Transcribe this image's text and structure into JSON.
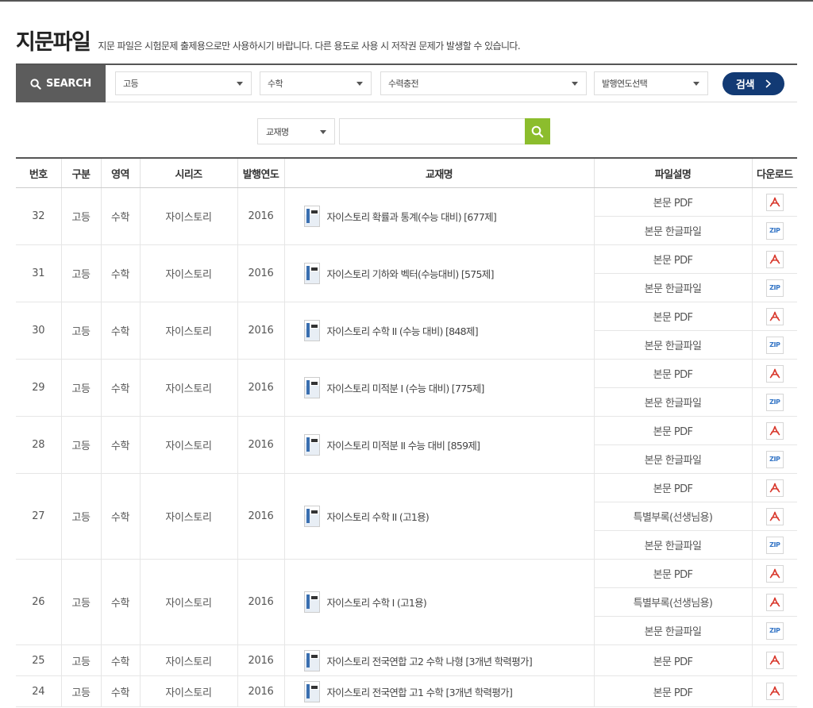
{
  "page": {
    "title": "지문파일",
    "description": "지문 파일은 시험문제 출제용으로만 사용하시기 바랍니다. 다른 용도로 사용 시 저작권 문제가 발생할 수 있습니다."
  },
  "search": {
    "label": "SEARCH",
    "level": "고등",
    "subject": "수학",
    "category": "수력충전",
    "year": "발행연도선택",
    "button": "검색"
  },
  "subsearch": {
    "field": "교재명",
    "value": "",
    "placeholder": ""
  },
  "table": {
    "headers": [
      "번호",
      "구분",
      "영역",
      "시리즈",
      "발행연도",
      "교재명",
      "파일설명",
      "다운로드"
    ],
    "rows": [
      {
        "no": "32",
        "level": "고등",
        "subject": "수학",
        "series": "자이스토리",
        "year": "2016",
        "title": "자이스토리 확률과 통계(수능 대비) [677제]",
        "files": [
          {
            "desc": "본문 PDF",
            "type": "pdf"
          },
          {
            "desc": "본문 한글파일",
            "type": "zip"
          }
        ]
      },
      {
        "no": "31",
        "level": "고등",
        "subject": "수학",
        "series": "자이스토리",
        "year": "2016",
        "title": "자이스토리 기하와 벡터(수능대비) [575제]",
        "files": [
          {
            "desc": "본문 PDF",
            "type": "pdf"
          },
          {
            "desc": "본문 한글파일",
            "type": "zip"
          }
        ]
      },
      {
        "no": "30",
        "level": "고등",
        "subject": "수학",
        "series": "자이스토리",
        "year": "2016",
        "title": "자이스토리 수학 II (수능 대비) [848제]",
        "files": [
          {
            "desc": "본문 PDF",
            "type": "pdf"
          },
          {
            "desc": "본문 한글파일",
            "type": "zip"
          }
        ]
      },
      {
        "no": "29",
        "level": "고등",
        "subject": "수학",
        "series": "자이스토리",
        "year": "2016",
        "title": "자이스토리 미적분 I (수능 대비) [775제]",
        "files": [
          {
            "desc": "본문 PDF",
            "type": "pdf"
          },
          {
            "desc": "본문 한글파일",
            "type": "zip"
          }
        ]
      },
      {
        "no": "28",
        "level": "고등",
        "subject": "수학",
        "series": "자이스토리",
        "year": "2016",
        "title": "자이스토리 미적분 II 수능 대비 [859제]",
        "files": [
          {
            "desc": "본문 PDF",
            "type": "pdf"
          },
          {
            "desc": "본문 한글파일",
            "type": "zip"
          }
        ]
      },
      {
        "no": "27",
        "level": "고등",
        "subject": "수학",
        "series": "자이스토리",
        "year": "2016",
        "title": "자이스토리 수학 II (고1용)",
        "files": [
          {
            "desc": "본문 PDF",
            "type": "pdf"
          },
          {
            "desc": "특별부록(선생님용)",
            "type": "pdf"
          },
          {
            "desc": "본문 한글파일",
            "type": "zip"
          }
        ]
      },
      {
        "no": "26",
        "level": "고등",
        "subject": "수학",
        "series": "자이스토리",
        "year": "2016",
        "title": "자이스토리 수학 I (고1용)",
        "files": [
          {
            "desc": "본문 PDF",
            "type": "pdf"
          },
          {
            "desc": "특별부록(선생님용)",
            "type": "pdf"
          },
          {
            "desc": "본문 한글파일",
            "type": "zip"
          }
        ]
      },
      {
        "no": "25",
        "level": "고등",
        "subject": "수학",
        "series": "자이스토리",
        "year": "2016",
        "title": "자이스토리 전국연합 고2 수학 나형 [3개년 학력평가]",
        "files": [
          {
            "desc": "본문 PDF",
            "type": "pdf"
          }
        ]
      },
      {
        "no": "24",
        "level": "고등",
        "subject": "수학",
        "series": "자이스토리",
        "year": "2016",
        "title": "자이스토리 전국연합 고1 수학 [3개년 학력평가]",
        "files": [
          {
            "desc": "본문 PDF",
            "type": "pdf"
          }
        ]
      }
    ]
  },
  "icons": {
    "search": "magnifier-icon",
    "chevron": "chevron-right-icon",
    "pdf": "pdf-icon",
    "zip": "zip-icon",
    "zip_label": "ZIP",
    "accent_navy": "#123a74",
    "accent_green": "#8cbd2d",
    "pdf_red": "#d8362a"
  }
}
